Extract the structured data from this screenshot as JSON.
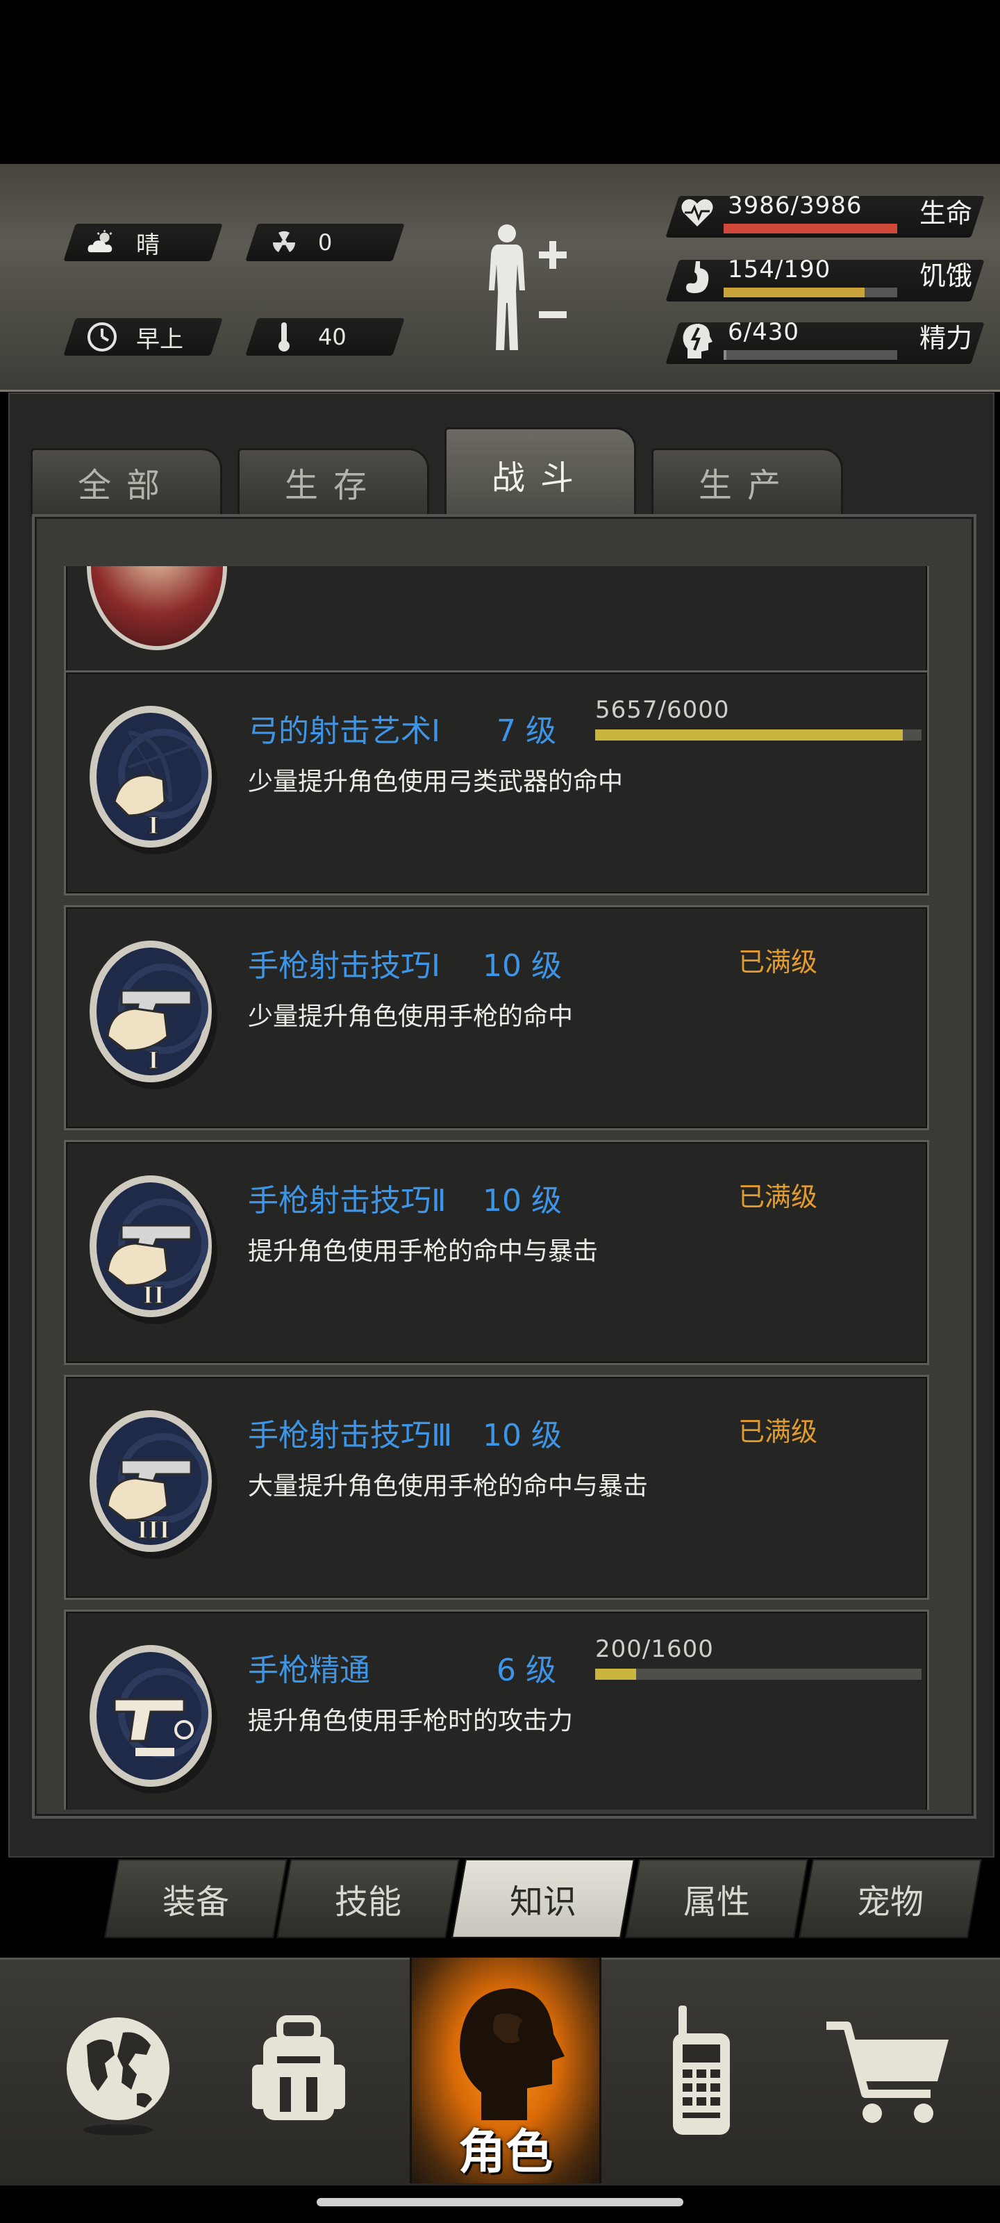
{
  "hud": {
    "weather": {
      "icon": "cloud-sun-icon",
      "label": "晴"
    },
    "radiation": {
      "icon": "radiation-icon",
      "value": "0"
    },
    "time": {
      "icon": "clock-icon",
      "label": "早上"
    },
    "temperature": {
      "icon": "thermometer-icon",
      "value": "40"
    },
    "stats": [
      {
        "icon": "heart-icon",
        "value": "3986/3986",
        "label": "生命",
        "fill": 1.0,
        "color": "#d0493b"
      },
      {
        "icon": "stomach-icon",
        "value": "154/190",
        "label": "饥饿",
        "fill": 0.81,
        "color": "#c8a43a"
      },
      {
        "icon": "head-energy-icon",
        "value": "6/430",
        "label": "精力",
        "fill": 0.014,
        "color": "#8a8a86"
      }
    ]
  },
  "tabs": [
    "全部",
    "生存",
    "战斗",
    "生产"
  ],
  "active_tab": "战斗",
  "skills": [
    {
      "name": "弓的射击艺术Ⅰ",
      "level": "7 级",
      "xp": "5657/6000",
      "progress": 0.943,
      "max": "",
      "desc": "少量提升角色使用弓类武器的命中",
      "icon": "bow-skill-icon",
      "roman": "I"
    },
    {
      "name": "手枪射击技巧Ⅰ",
      "level": "10 级",
      "xp": "",
      "progress": null,
      "max": "已满级",
      "desc": "少量提升角色使用手枪的命中",
      "icon": "pistol-skill-icon",
      "roman": "I"
    },
    {
      "name": "手枪射击技巧Ⅱ",
      "level": "10 级",
      "xp": "",
      "progress": null,
      "max": "已满级",
      "desc": "提升角色使用手枪的命中与暴击",
      "icon": "pistol-skill-icon",
      "roman": "II"
    },
    {
      "name": "手枪射击技巧Ⅲ",
      "level": "10 级",
      "xp": "",
      "progress": null,
      "max": "已满级",
      "desc": "大量提升角色使用手枪的命中与暴击",
      "icon": "pistol-skill-icon",
      "roman": "III"
    },
    {
      "name": "手枪精通",
      "level": "6 级",
      "xp": "200/1600",
      "progress": 0.125,
      "max": "",
      "desc": "提升角色使用手枪时的攻击力",
      "icon": "pistol-mastery-icon",
      "roman": ""
    }
  ],
  "subtabs": [
    "装备",
    "技能",
    "知识",
    "属性",
    "宠物"
  ],
  "active_subtab": "知识",
  "nav": {
    "world": {
      "icon": "globe-icon"
    },
    "backpack": {
      "icon": "backpack-icon"
    },
    "character": {
      "icon": "character-head-icon",
      "label": "角色"
    },
    "radio": {
      "icon": "walkie-talkie-icon"
    },
    "shop": {
      "icon": "cart-icon"
    }
  }
}
